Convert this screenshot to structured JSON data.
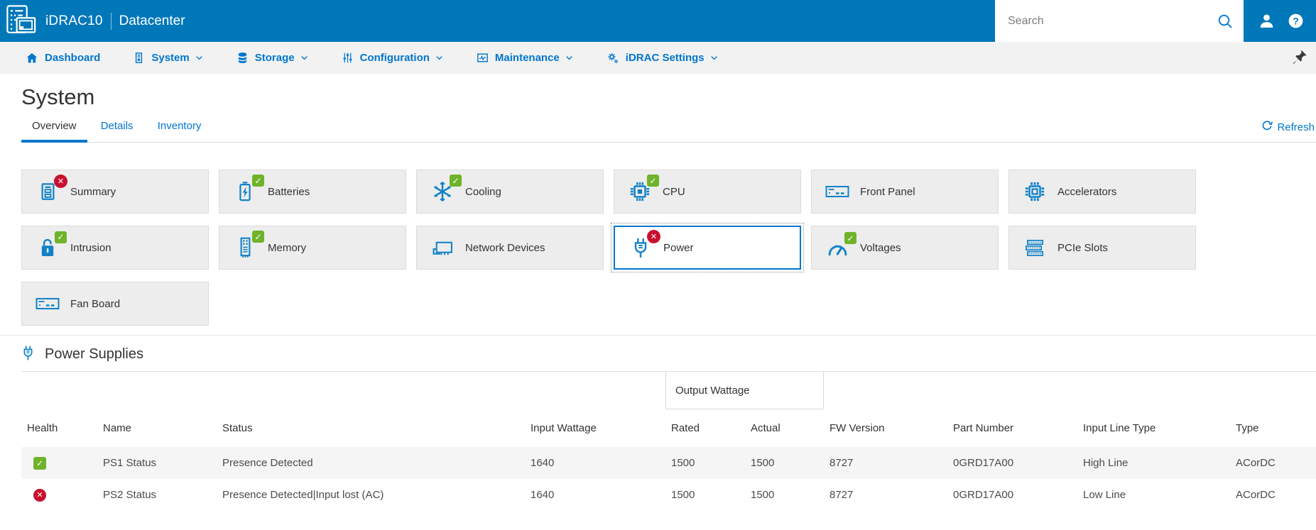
{
  "header": {
    "brand": "iDRAC10",
    "product": "Datacenter",
    "search_placeholder": "Search",
    "icons": [
      "app-logo",
      "search-icon",
      "user-icon",
      "help-icon"
    ]
  },
  "nav": {
    "items": [
      {
        "label": "Dashboard",
        "icon": "home-icon",
        "has_dropdown": false
      },
      {
        "label": "System",
        "icon": "server-icon",
        "has_dropdown": true
      },
      {
        "label": "Storage",
        "icon": "storage-icon",
        "has_dropdown": true
      },
      {
        "label": "Configuration",
        "icon": "sliders-icon",
        "has_dropdown": true
      },
      {
        "label": "Maintenance",
        "icon": "maintenance-icon",
        "has_dropdown": true
      },
      {
        "label": "iDRAC Settings",
        "icon": "gears-icon",
        "has_dropdown": true
      }
    ],
    "pin_icon": "pin-icon"
  },
  "page": {
    "title": "System",
    "tabs": [
      {
        "label": "Overview",
        "active": true
      },
      {
        "label": "Details",
        "active": false
      },
      {
        "label": "Inventory",
        "active": false
      }
    ],
    "refresh_label": "Refresh",
    "refresh_icon": "refresh-icon"
  },
  "tiles": [
    {
      "label": "Summary",
      "icon": "summary-icon",
      "status": "error",
      "selected": false
    },
    {
      "label": "Batteries",
      "icon": "battery-icon",
      "status": "ok",
      "selected": false
    },
    {
      "label": "Cooling",
      "icon": "snowflake-icon",
      "status": "ok",
      "selected": false
    },
    {
      "label": "CPU",
      "icon": "cpu-icon",
      "status": "ok",
      "selected": false
    },
    {
      "label": "Front Panel",
      "icon": "front-panel-icon",
      "status": "none",
      "selected": false
    },
    {
      "label": "Accelerators",
      "icon": "accelerator-chip-icon",
      "status": "none",
      "selected": false
    },
    {
      "label": "Intrusion",
      "icon": "open-lock-icon",
      "status": "ok",
      "selected": false
    },
    {
      "label": "Memory",
      "icon": "memory-stick-icon",
      "status": "ok",
      "selected": false
    },
    {
      "label": "Network Devices",
      "icon": "network-card-icon",
      "status": "none",
      "selected": false
    },
    {
      "label": "Power",
      "icon": "power-plug-icon",
      "status": "error",
      "selected": true
    },
    {
      "label": "Voltages",
      "icon": "gauge-icon",
      "status": "ok",
      "selected": false
    },
    {
      "label": "PCIe Slots",
      "icon": "pcie-slots-icon",
      "status": "none",
      "selected": false
    },
    {
      "label": "Fan Board",
      "icon": "fan-board-icon",
      "status": "none",
      "selected": false
    }
  ],
  "power_supplies": {
    "section_title": "Power Supplies",
    "section_icon": "power-plug-icon",
    "group_header": "Output Wattage",
    "columns": [
      "Health",
      "Name",
      "Status",
      "Input Wattage",
      "Rated",
      "Actual",
      "FW Version",
      "Part Number",
      "Input Line Type",
      "Type"
    ],
    "rows": [
      {
        "health": "ok",
        "name": "PS1 Status",
        "status": "Presence Detected",
        "input_wattage": "1640",
        "rated": "1500",
        "actual": "1500",
        "fw_version": "8727",
        "part_number": "0GRD17A00",
        "input_line_type": "High Line",
        "type": "ACorDC"
      },
      {
        "health": "error",
        "name": "PS2 Status",
        "status": "Presence Detected|Input lost (AC)",
        "input_wattage": "1640",
        "rated": "1500",
        "actual": "1500",
        "fw_version": "8727",
        "part_number": "0GRD17A00",
        "input_line_type": "Low Line",
        "type": "ACorDC"
      }
    ]
  },
  "colors": {
    "header_blue": "#0077b8",
    "link_blue": "#0076ce",
    "icon_blue": "#1282c8",
    "ok_green": "#6fb32a",
    "error_red": "#c8102e",
    "nav_bg": "#f2f2f2",
    "tile_bg": "#ededed",
    "row_shade": "#f5f5f5"
  }
}
